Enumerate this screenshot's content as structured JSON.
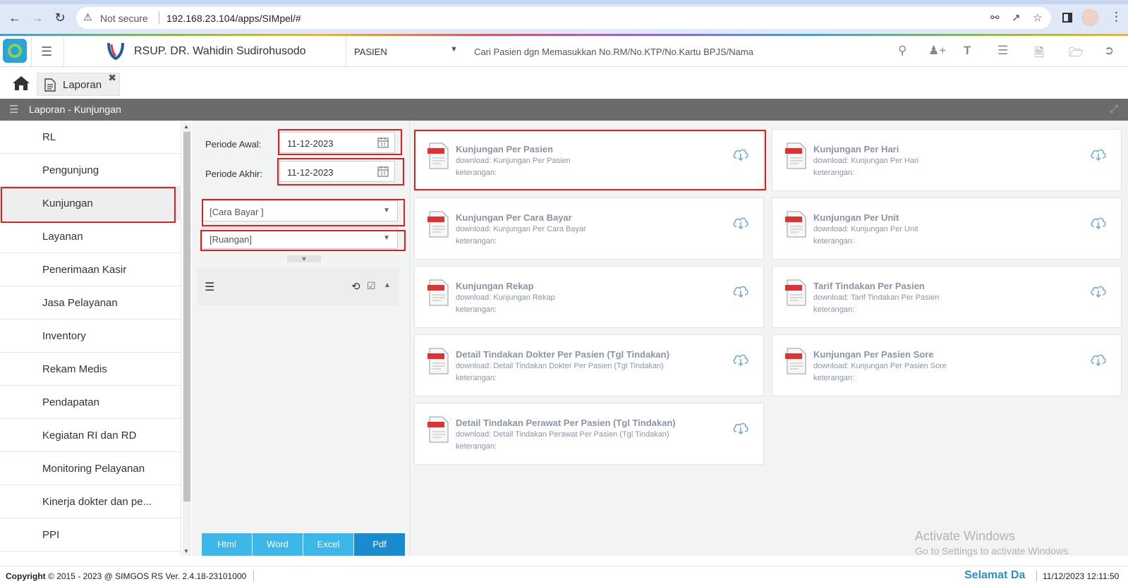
{
  "browser": {
    "security_label": "Not secure",
    "url": "192.168.23.104/apps/SIMpel/#"
  },
  "header": {
    "hospital_name": "RSUP. DR. Wahidin Sudirohusodo",
    "patient_select": "PASIEN",
    "search_placeholder": "Cari Pasien dgn Memasukkan No.RM/No.KTP/No.Kartu BPJS/Nama"
  },
  "tabs": [
    {
      "label": "Laporan"
    }
  ],
  "titlebar": {
    "title": "Laporan - Kunjungan"
  },
  "sidebar": {
    "active": "Kunjungan",
    "items": [
      {
        "label": "RL"
      },
      {
        "label": "Pengunjung"
      },
      {
        "label": "Kunjungan"
      },
      {
        "label": "Layanan"
      },
      {
        "label": "Penerimaan Kasir"
      },
      {
        "label": "Jasa Pelayanan"
      },
      {
        "label": "Inventory"
      },
      {
        "label": "Rekam Medis"
      },
      {
        "label": "Pendapatan"
      },
      {
        "label": "Kegiatan RI dan RD"
      },
      {
        "label": "Monitoring Pelayanan"
      },
      {
        "label": "Kinerja dokter dan pe..."
      },
      {
        "label": "PPI"
      }
    ]
  },
  "filters": {
    "periode_awal_label": "Periode Awal:",
    "periode_awal_value": "11-12-2023",
    "periode_akhir_label": "Periode Akhir:",
    "periode_akhir_value": "11-12-2023",
    "cara_bayar": "[Cara Bayar ]",
    "ruangan": "[Ruangan]"
  },
  "export_buttons": [
    {
      "label": "Html"
    },
    {
      "label": "Word"
    },
    {
      "label": "Excel"
    },
    {
      "label": "Pdf"
    }
  ],
  "reports": [
    {
      "title": "Kunjungan Per Pasien",
      "download": "download: Kunjungan Per Pasien",
      "keterangan": "keterangan:"
    },
    {
      "title": "Kunjungan Per Hari",
      "download": "download: Kunjungan Per Hari",
      "keterangan": "keterangan:"
    },
    {
      "title": "Kunjungan Per Cara Bayar",
      "download": "download: Kunjungan Per Cara Bayar",
      "keterangan": "keterangan:"
    },
    {
      "title": "Kunjungan Per Unit",
      "download": "download: Kunjungan Per Unit",
      "keterangan": "keterangan:"
    },
    {
      "title": "Kunjungan Rekap",
      "download": "download: Kunjungan Rekap",
      "keterangan": "keterangan:"
    },
    {
      "title": "Tarif Tindakan Per Pasien",
      "download": "download: Tarif Tindakan Per Pasien",
      "keterangan": "keterangan:"
    },
    {
      "title": "Detail Tindakan Dokter Per Pasien (Tgl Tindakan)",
      "download": "download: Detail Tindakan Dokter Per Pasien (Tgl Tindakan)",
      "keterangan": "keterangan:"
    },
    {
      "title": "Kunjungan Per Pasien Sore",
      "download": "download: Kunjungan Per Pasien Sore",
      "keterangan": "keterangan:"
    },
    {
      "title": "Detail Tindakan Perawat Per Pasien (Tgl Tindakan)",
      "download": "download: Detail Tindakan Perawat Per Pasien (Tgl Tindakan)",
      "keterangan": "keterangan:"
    }
  ],
  "watermark": {
    "line1": "Activate Windows",
    "line2": "Go to Settings to activate Windows."
  },
  "footer": {
    "copyright_label": "Copyright",
    "copyright_text": "2015 - 2023 @ SIMGOS RS Ver. 2.4.18-23101000",
    "welcome": "Selamat Da",
    "datetime": "11/12/2023 12:11:50"
  },
  "colors": {
    "accent": "#3db6e8",
    "accent_active": "#1b8bd0",
    "highlight": "#e02020",
    "titlebar": "#6c6a6a"
  }
}
